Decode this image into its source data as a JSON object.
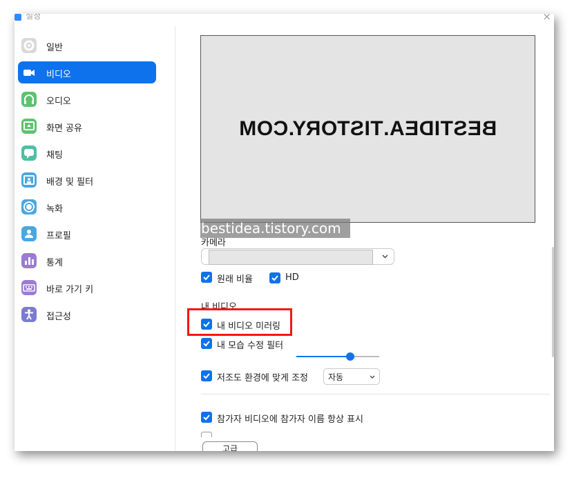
{
  "window": {
    "title": "설정",
    "close_glyph": "×"
  },
  "sidebar": {
    "items": [
      {
        "label": "일반",
        "icon": "gear-icon",
        "color": "#c9c9c9"
      },
      {
        "label": "비디오",
        "icon": "video-camera-icon",
        "color": "#ffffff",
        "active": true
      },
      {
        "label": "오디오",
        "icon": "headphones-icon",
        "color": "#5cc36e"
      },
      {
        "label": "화면 공유",
        "icon": "share-screen-icon",
        "color": "#5cc36e"
      },
      {
        "label": "채팅",
        "icon": "chat-bubble-icon",
        "color": "#4dbfa3"
      },
      {
        "label": "배경 및 필터",
        "icon": "background-icon",
        "color": "#4aa7e0"
      },
      {
        "label": "녹화",
        "icon": "record-icon",
        "color": "#4aa7e0"
      },
      {
        "label": "프로필",
        "icon": "profile-icon",
        "color": "#4aa7e0"
      },
      {
        "label": "통계",
        "icon": "stats-icon",
        "color": "#9b7bd3"
      },
      {
        "label": "바로 가기 키",
        "icon": "keyboard-icon",
        "color": "#9b7bd3"
      },
      {
        "label": "접근성",
        "icon": "accessibility-icon",
        "color": "#7b7bd3"
      }
    ]
  },
  "preview": {
    "text": "BESTIDEA.TISTORY.COM",
    "watermark": "bestidea.tistory.com"
  },
  "camera": {
    "label": "카메라",
    "selected": ""
  },
  "options": {
    "original_ratio": "원래 비율",
    "hd": "HD",
    "my_video_label": "내 비디오",
    "mirror": "내 비디오 미러링",
    "touch_up": "내 모습 수정 필터",
    "touch_up_level": 0.65,
    "low_light": "저조도 환경에 맞게 조정",
    "low_light_mode": "자동",
    "always_show_names": "참가자 비디오에 참가자 이름 항상 표시"
  },
  "advanced_button": "고급",
  "accent_color": "#0e72ed",
  "highlight_color": "#ff1111"
}
